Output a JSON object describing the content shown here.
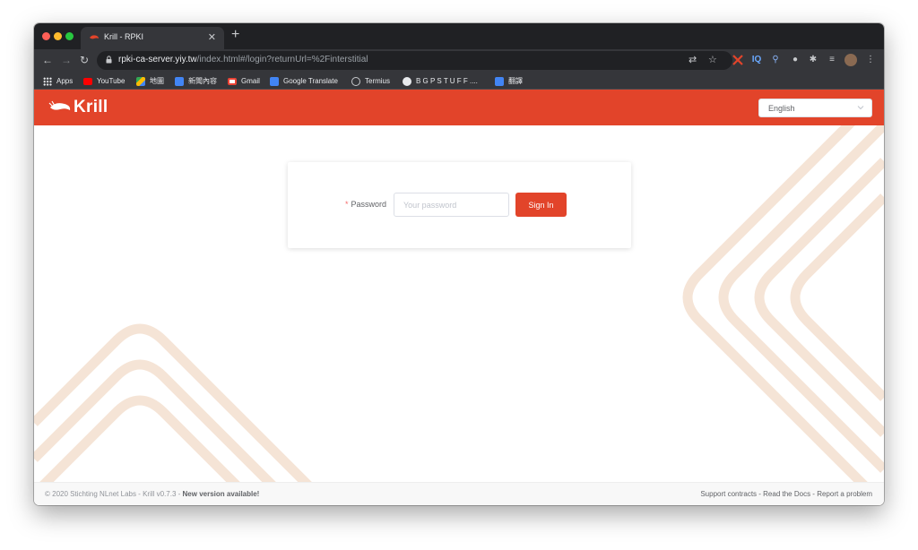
{
  "browser": {
    "tab": {
      "title": "Krill - RPKI"
    },
    "url": {
      "host": "rpki-ca-server.yiy.tw",
      "path": "/index.html#/login?returnUrl=%2Finterstitial"
    },
    "extensions": [
      "IQ"
    ],
    "bookmarks": [
      {
        "label": "Apps",
        "icon": "apps-grid-icon"
      },
      {
        "label": "YouTube",
        "icon": "youtube-icon"
      },
      {
        "label": "地圖",
        "icon": "maps-icon"
      },
      {
        "label": "新聞內容",
        "icon": "news-icon"
      },
      {
        "label": "Gmail",
        "icon": "gmail-icon"
      },
      {
        "label": "Google Translate",
        "icon": "translate-icon"
      },
      {
        "label": "Termius",
        "icon": "termius-icon"
      },
      {
        "label": "B G P S T U F F ....",
        "icon": "globe-icon"
      },
      {
        "label": "翻譯",
        "icon": "translate-icon"
      }
    ]
  },
  "header": {
    "brand": "Krill",
    "language": "English"
  },
  "login": {
    "required_mark": "*",
    "password_label": "Password",
    "password_placeholder": "Your password",
    "signin_label": "Sign In"
  },
  "footer": {
    "copyright": "© 2020 Stichting NLnet Labs - Krill v0.7.3 - ",
    "new_version": "New version available!",
    "links": [
      "Support contracts",
      "Read the Docs",
      "Report a problem"
    ],
    "separator": " - "
  },
  "colors": {
    "accent": "#e2442a",
    "decoration": "#f5e4d6",
    "chrome_dark": "#202124",
    "chrome_toolbar": "#35363a"
  }
}
